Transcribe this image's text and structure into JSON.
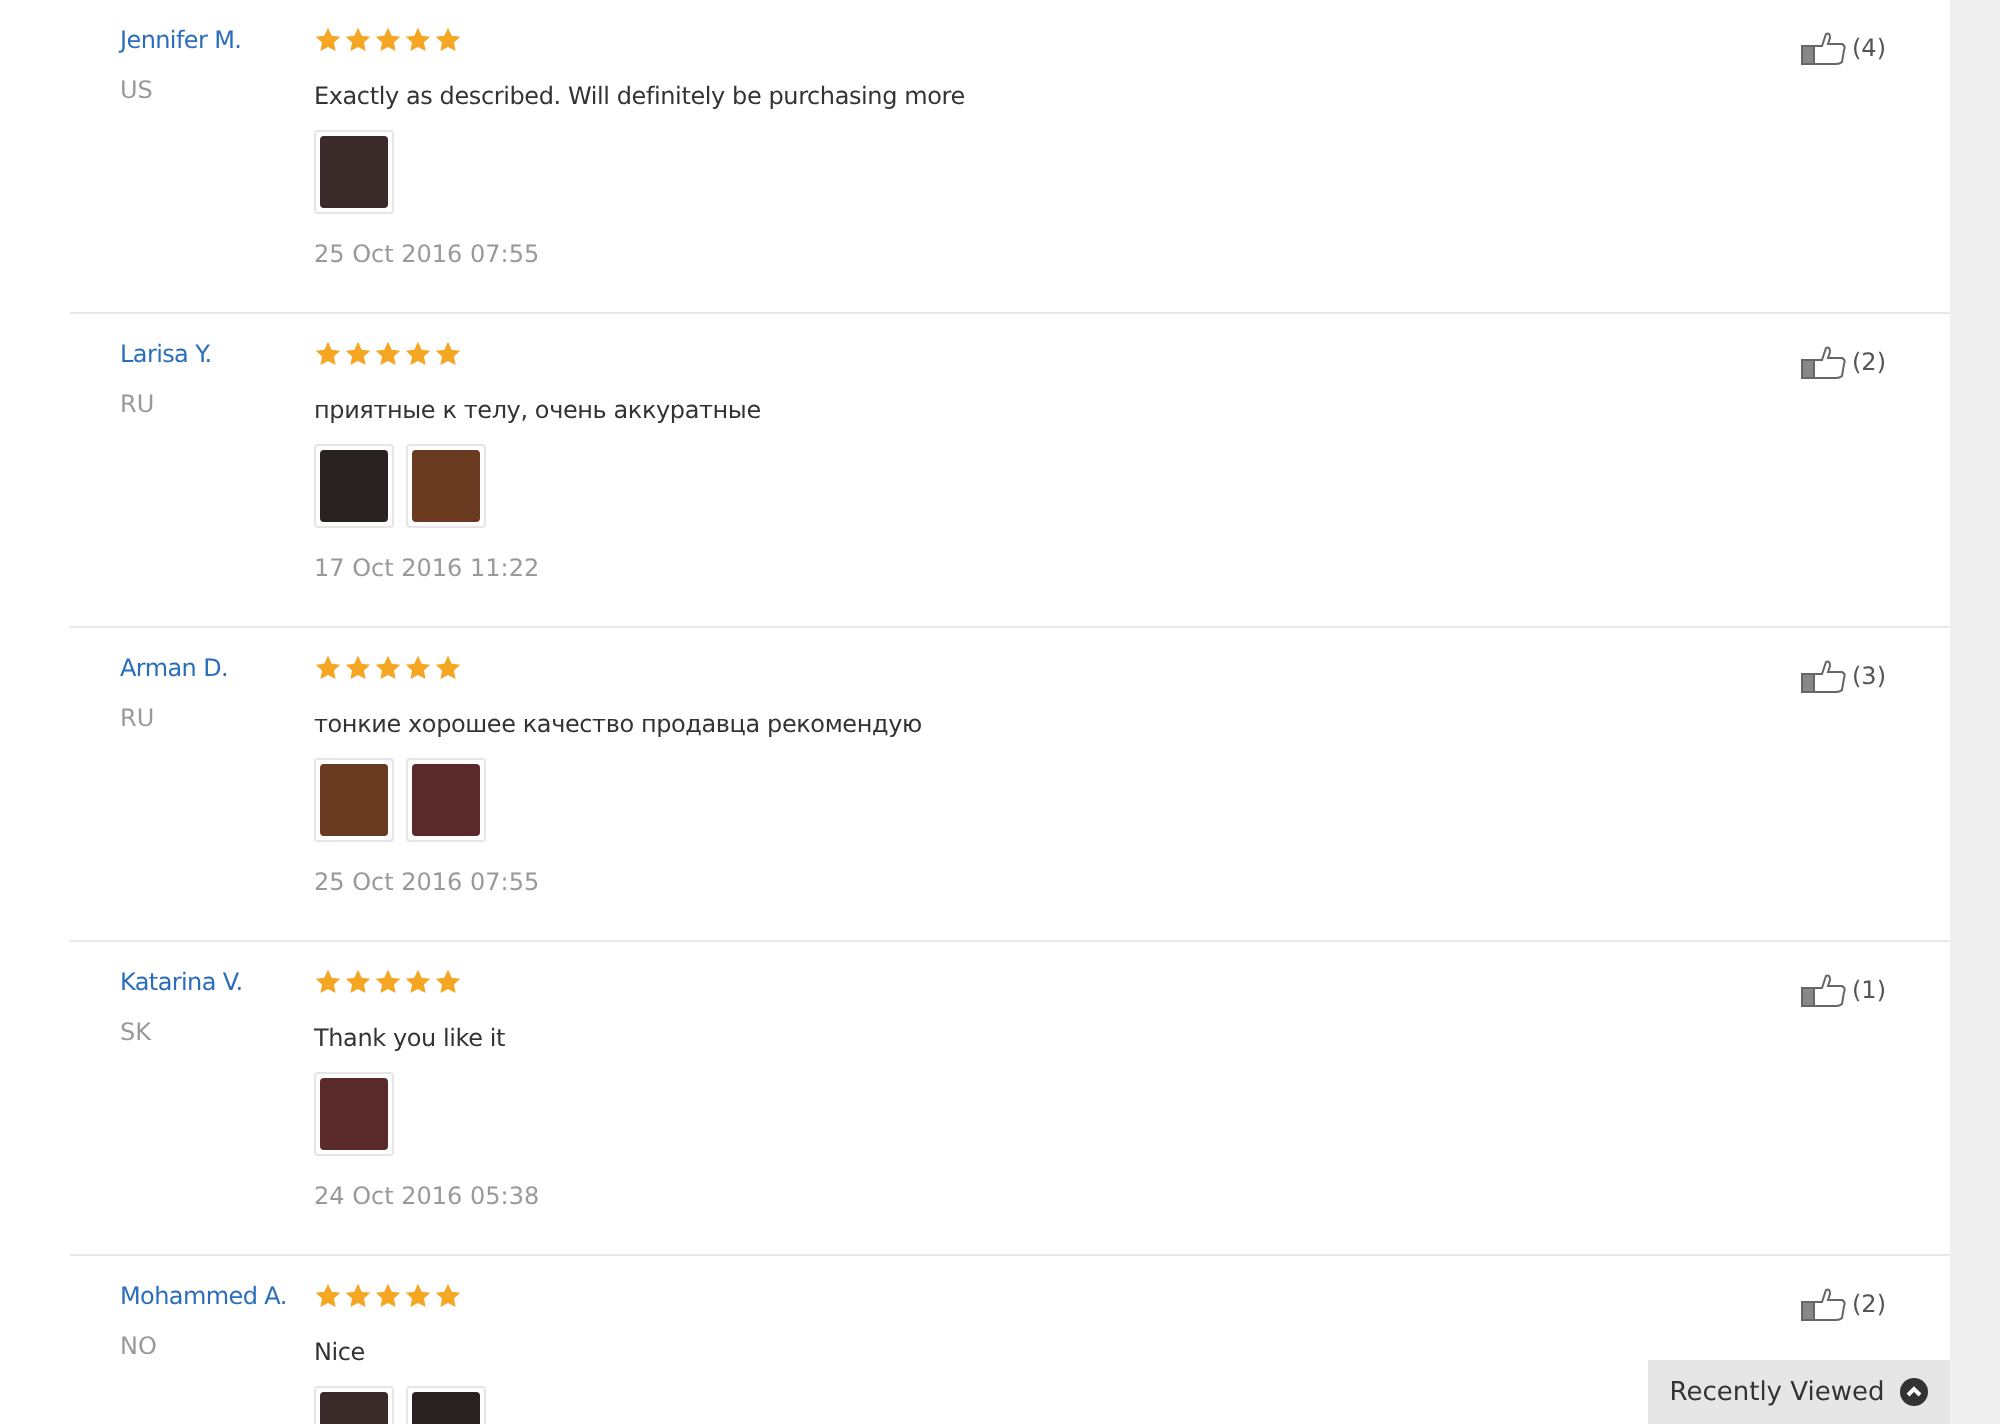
{
  "reviews": [
    {
      "name": "Jennifer M.",
      "country": "US",
      "stars": 5,
      "text": "Exactly as described. Will definitely be purchasing more",
      "photos": [
        {
          "kind": "photo"
        }
      ],
      "date": "25 Oct 2016 07:55",
      "helpful": "(4)"
    },
    {
      "name": "Larisa Y.",
      "country": "RU",
      "stars": 5,
      "text": "приятные к телу, очень аккуратные",
      "photos": [
        {
          "kind": "photo"
        },
        {
          "kind": "photo"
        }
      ],
      "date": "17 Oct 2016 11:22",
      "helpful": "(2)"
    },
    {
      "name": "Arman D.",
      "country": "RU",
      "stars": 5,
      "text": "тонкие хорошее качество продавца рекомендую",
      "photos": [
        {
          "kind": "photo"
        },
        {
          "kind": "photo"
        }
      ],
      "date": "25 Oct 2016 07:55",
      "helpful": "(3)"
    },
    {
      "name": "Katarina V.",
      "country": "SK",
      "stars": 5,
      "text": "Thank you like it",
      "photos": [
        {
          "kind": "photo"
        }
      ],
      "date": "24 Oct 2016 05:38",
      "helpful": "(1)"
    },
    {
      "name": "Mohammed A.",
      "country": "NO",
      "stars": 5,
      "text": "Nice",
      "photos": [
        {
          "kind": "photo"
        },
        {
          "kind": "photo"
        }
      ],
      "helpful": "(2)"
    }
  ],
  "recently_viewed": {
    "label": "Recently Viewed"
  }
}
